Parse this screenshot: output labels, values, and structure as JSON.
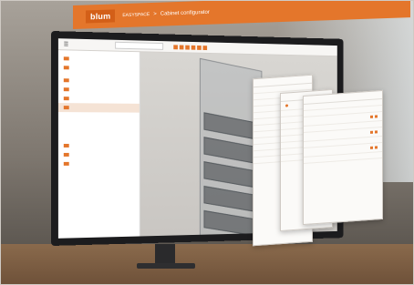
{
  "header": {
    "logo_text": "blum",
    "app_name": "EASYSPACE",
    "separator": ">",
    "page_title": "Cabinet configurator",
    "accent_color": "#e4762b"
  },
  "toolbar": {
    "menu_icon": "hamburger-icon",
    "back_label": "",
    "search_placeholder": "",
    "right_items": [
      "",
      "",
      ""
    ]
  },
  "sidebar": {
    "sections": [
      {
        "title": "",
        "items": [
          "",
          ""
        ]
      },
      {
        "title": "",
        "items": [
          "",
          "",
          "",
          ""
        ]
      },
      {
        "title": "",
        "items": [
          "",
          "",
          "",
          ""
        ]
      },
      {
        "title": "",
        "items": [
          "",
          "",
          ""
        ]
      }
    ]
  },
  "panels": {
    "p1": {
      "title": "",
      "rows": [
        "",
        "",
        "",
        "",
        "",
        "",
        "",
        "",
        "",
        "",
        "",
        ""
      ]
    },
    "p2": {
      "title": "",
      "rows": [
        "",
        "",
        "",
        "",
        "",
        "",
        "",
        "",
        ""
      ]
    },
    "p3": {
      "title": "",
      "rows": [
        "",
        "",
        "",
        "",
        "",
        "",
        "",
        ""
      ]
    }
  }
}
